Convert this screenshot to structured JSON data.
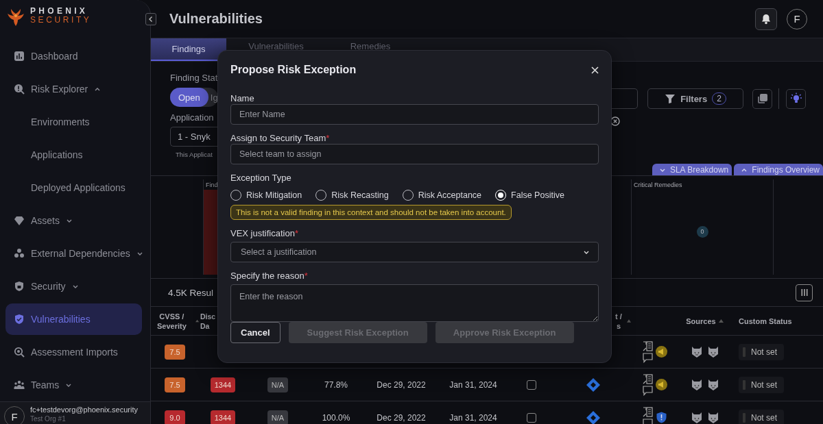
{
  "brand": {
    "name": "PHOENIX",
    "tagline": "SECURITY"
  },
  "sidebar": {
    "items": [
      {
        "label": "Dashboard",
        "selected": false
      },
      {
        "label": "Risk Explorer",
        "selected": false,
        "expanded": true,
        "children": [
          {
            "label": "Environments",
            "selected": false
          },
          {
            "label": "Applications",
            "selected": false
          },
          {
            "label": "Deployed Applications",
            "selected": false
          }
        ]
      },
      {
        "label": "Assets",
        "selected": false,
        "expanded": false
      },
      {
        "label": "External Dependencies",
        "selected": false,
        "expanded": false
      },
      {
        "label": "Security",
        "selected": false,
        "expanded": false
      },
      {
        "label": "Vulnerabilities",
        "selected": true
      },
      {
        "label": "Assessment Imports",
        "selected": false
      },
      {
        "label": "Teams",
        "selected": false,
        "expanded": false
      }
    ],
    "user": {
      "avatar": "F",
      "email": "fc+testdevorg@phoenix.security",
      "org": "Test Org #1"
    }
  },
  "header": {
    "title": "Vulnerabilities",
    "avatar": "F"
  },
  "tabs": [
    {
      "label": "Findings",
      "selected": true
    },
    {
      "label": "Vulnerabilities",
      "selected": false
    },
    {
      "label": "Remedies",
      "selected": false
    }
  ],
  "filters": {
    "status_label": "Finding Stat",
    "status_options": [
      {
        "label": "Open",
        "selected": true
      },
      {
        "label": "Ig",
        "selected": false
      }
    ],
    "application_label": "Application",
    "application_value": "1 - Snyk",
    "application_hint": "This Applicat",
    "filters_button": "Filters",
    "filters_count": "2"
  },
  "panel_toggles": [
    {
      "label": "SLA Breakdown",
      "expanded": false
    },
    {
      "label": "Findings Overview",
      "expanded": true
    }
  ],
  "charts": [
    {
      "title": "Find"
    },
    {
      "title": "Critical Remedies",
      "count": "0"
    }
  ],
  "results": {
    "count": "4.5K Resul"
  },
  "table": {
    "columns": [
      {
        "label": "CVSS / Severity",
        "sorted": true
      },
      {
        "label": "Disc Da",
        "sorted": false
      },
      {
        "label": "t / s",
        "sorted": true
      },
      {
        "label": "Sources",
        "sorted": true
      },
      {
        "label": "Custom Status",
        "sorted": false
      }
    ],
    "rows": [
      {
        "cvss": "7.5",
        "color": "#c8632c",
        "kind": "warning",
        "status": "Not set"
      },
      {
        "cvss": "7.5",
        "color": "#c8632c",
        "cells": [
          "1344",
          "N/A",
          "77.8%",
          "Dec 29, 2022",
          "Jan 31, 2024"
        ],
        "checked": false,
        "ticket": true,
        "kind": "warning",
        "status": "Not set"
      },
      {
        "cvss": "9.0",
        "color": "#b7292e",
        "cells": [
          "1344",
          "N/A",
          "100.0%",
          "Dec 29, 2022",
          "Jan 31, 2024"
        ],
        "checked": false,
        "ticket": true,
        "kind": "alert",
        "status": "Not set"
      }
    ]
  },
  "modal": {
    "title": "Propose Risk Exception",
    "fields": [
      {
        "kind": "text",
        "label": "Name",
        "placeholder": "Enter Name"
      },
      {
        "kind": "picker",
        "label": "Assign to Security Team",
        "required_mark": "*",
        "placeholder": "Select team to assign"
      },
      {
        "kind": "radio-group",
        "label": "Exception Type",
        "options": [
          {
            "label": "Risk Mitigation",
            "selected": false
          },
          {
            "label": "Risk Recasting",
            "selected": false
          },
          {
            "label": "Risk Acceptance",
            "selected": false
          },
          {
            "label": "False Positive",
            "selected": true
          }
        ],
        "note": "This is not a valid finding in this context and should not be taken into account."
      },
      {
        "kind": "dropdown",
        "label": "VEX justification",
        "required_mark": "*",
        "placeholder": "Select a justification"
      },
      {
        "kind": "textarea",
        "label": "Specify the reason",
        "required_mark": "*",
        "placeholder": "Enter the reason"
      }
    ],
    "buttons": [
      {
        "label": "Cancel",
        "disabled": false
      },
      {
        "label": "Suggest Risk Exception",
        "disabled": true
      },
      {
        "label": "Approve Risk Exception",
        "disabled": true
      }
    ]
  }
}
